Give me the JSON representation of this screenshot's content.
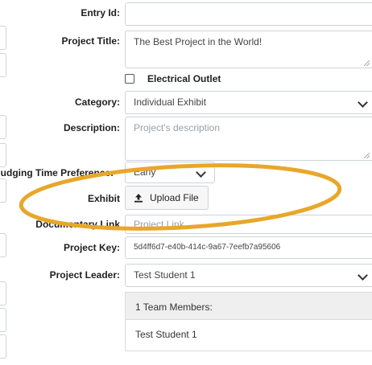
{
  "form": {
    "entry_id": {
      "label": "Entry Id:",
      "value": ""
    },
    "project_title": {
      "label": "Project Title:",
      "value": "The Best Project in the World!"
    },
    "electrical_outlet": {
      "label": "Electrical Outlet",
      "checked": false
    },
    "category": {
      "label": "Category:",
      "value": "Individual Exhibit"
    },
    "description": {
      "label": "Description:",
      "placeholder": "Project's description"
    },
    "judging_time": {
      "label": "Judging Time Preference:",
      "value": "Early"
    },
    "exhibit": {
      "label": "Exhibit",
      "button_label": "Upload File",
      "icon": "upload-icon"
    },
    "documentary_link": {
      "label": "Documentary Link",
      "placeholder": "Project Link"
    },
    "project_key": {
      "label": "Project Key:",
      "value": "5d4ff6d7-e40b-414c-9a67-7eefb7a95606"
    },
    "project_leader": {
      "label": "Project Leader:",
      "value": "Test Student 1"
    },
    "team": {
      "header": "1 Team Members:",
      "members": [
        "Test Student 1"
      ]
    }
  },
  "annotation": {
    "type": "ellipse",
    "color": "#e8a72a"
  }
}
